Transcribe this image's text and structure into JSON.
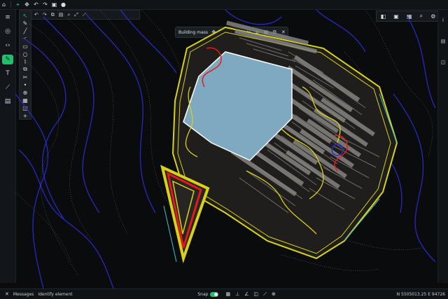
{
  "top_toolbar": {
    "icons": [
      "app-icon",
      "select-icon",
      "pan-icon",
      "undo-icon",
      "redo-icon",
      "save-icon",
      "export-icon"
    ]
  },
  "left_rail": {
    "items": [
      "menu-icon",
      "layers-icon",
      "code-icon",
      "pen-icon",
      "text-icon",
      "measure-icon",
      "folder-icon"
    ]
  },
  "drawing_tools": [
    "cursor-icon",
    "pen-icon",
    "line-icon",
    "arc-icon",
    "rectangle-icon",
    "circle-icon",
    "polyline-icon",
    "offset-icon",
    "trim-icon",
    "point-icon",
    "target-icon",
    "grid-icon",
    "layer-icon",
    "add-icon"
  ],
  "floating_toolbar": {
    "label": "Building mass",
    "icons": [
      "move-icon",
      "rotate-icon",
      "scale-icon",
      "copy-icon",
      "mirror-icon",
      "align-icon",
      "array-icon",
      "settings-icon",
      "delete-icon"
    ]
  },
  "right_toolbar": {
    "icons": [
      "view-icon",
      "panel-icon",
      "grid-icon",
      "zoom-icon",
      "settings-icon"
    ]
  },
  "status_bar": {
    "messages": "Messages",
    "identify": "Identify element",
    "snap": "Snap",
    "coords": "N 5505013.25 E 94726"
  },
  "colors": {
    "accent": "#1fbf6b",
    "building": "#7ea9c0",
    "contour": "#2427b8",
    "parking": "#2b2a29",
    "yellow": "#d9d21a",
    "red": "#e21a1a"
  }
}
